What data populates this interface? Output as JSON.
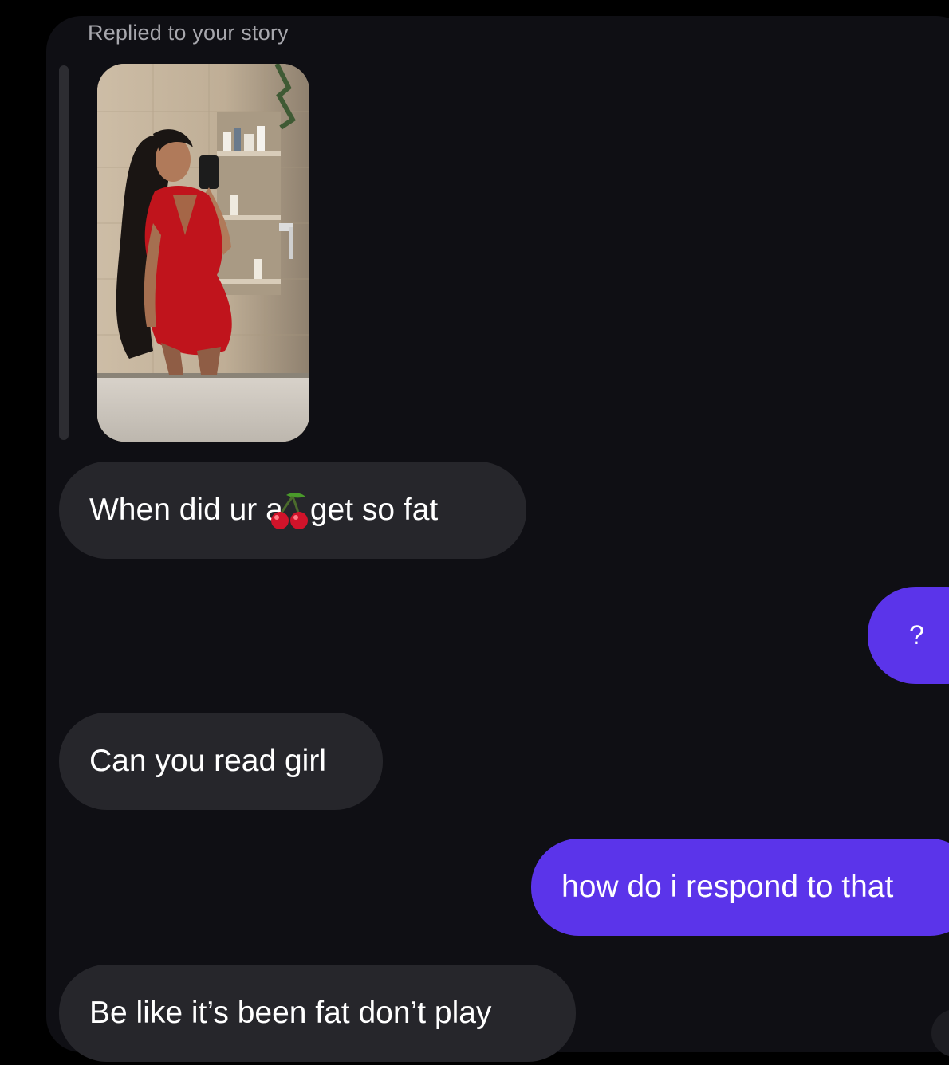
{
  "thread": {
    "reply_label": "Replied to your story",
    "messages": [
      {
        "from": "them",
        "text_before": "When did ur a",
        "emoji": "cherry-emoji",
        "text_after": " get so fat"
      },
      {
        "from": "me",
        "text": "?"
      },
      {
        "from": "them",
        "text": "Can you read girl"
      },
      {
        "from": "me",
        "text": "how do i respond to that"
      },
      {
        "from": "them",
        "text": "Be like it’s been fat don’t play"
      }
    ]
  },
  "colors": {
    "background": "#000000",
    "panel": "#0f0f14",
    "incoming_bubble": "#26262b",
    "outgoing_bubble": "#5b34ea",
    "reply_label": "#a7a7ad"
  },
  "icons": {
    "story_thumbnail": "story-photo-thumbnail",
    "emoji": "cherry-emoji"
  }
}
